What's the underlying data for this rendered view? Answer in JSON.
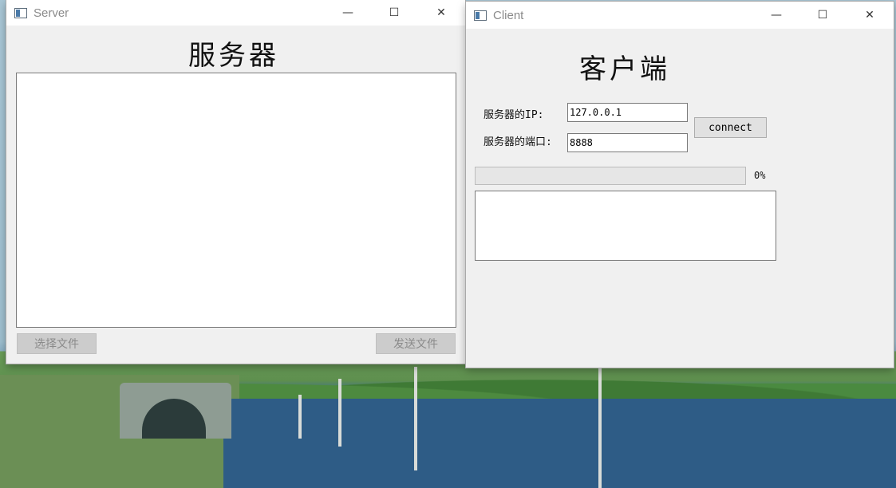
{
  "server": {
    "window_title": "Server",
    "heading": "服务器",
    "select_file_label": "选择文件",
    "send_file_label": "发送文件",
    "log_text": ""
  },
  "client": {
    "window_title": "Client",
    "heading": "客户端",
    "ip_label": "服务器的IP:",
    "ip_value": "127.0.0.1",
    "port_label": "服务器的端口:",
    "port_value": "8888",
    "connect_label": "connect",
    "progress_percent": 0,
    "progress_text": "0%",
    "log_text": ""
  },
  "window_controls": {
    "minimize": "—",
    "maximize": "☐",
    "close": "✕"
  }
}
